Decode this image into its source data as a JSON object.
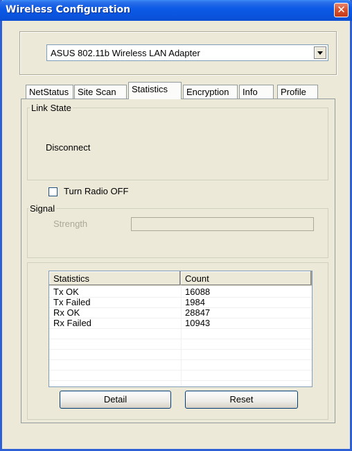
{
  "window": {
    "title": "Wireless Configuration",
    "close_glyph": "✕"
  },
  "adapter": {
    "selected": "ASUS 802.11b Wireless LAN Adapter"
  },
  "tabs": [
    {
      "label": "NetStatus"
    },
    {
      "label": "Site Scan"
    },
    {
      "label": "Statistics",
      "active": true
    },
    {
      "label": "Encryption"
    },
    {
      "label": "Info"
    },
    {
      "label": "Profile"
    }
  ],
  "link_state": {
    "legend": "Link State",
    "value": "Disconnect"
  },
  "radio": {
    "label": "Turn Radio OFF",
    "checked": false
  },
  "signal": {
    "legend": "Signal",
    "strength_label": "Strength",
    "strength_level": 0
  },
  "stats_table": {
    "headers": [
      "Statistics",
      "Count"
    ],
    "rows": [
      {
        "name": "Tx OK",
        "count": "16088"
      },
      {
        "name": "Tx Failed",
        "count": "1984"
      },
      {
        "name": "Rx OK",
        "count": "28847"
      },
      {
        "name": "Rx Failed",
        "count": "10943"
      }
    ]
  },
  "buttons": {
    "detail": "Detail",
    "reset": "Reset"
  },
  "colors": {
    "title_bar": "#0a55e0",
    "face": "#ece9d8",
    "close": "#d5502c"
  }
}
